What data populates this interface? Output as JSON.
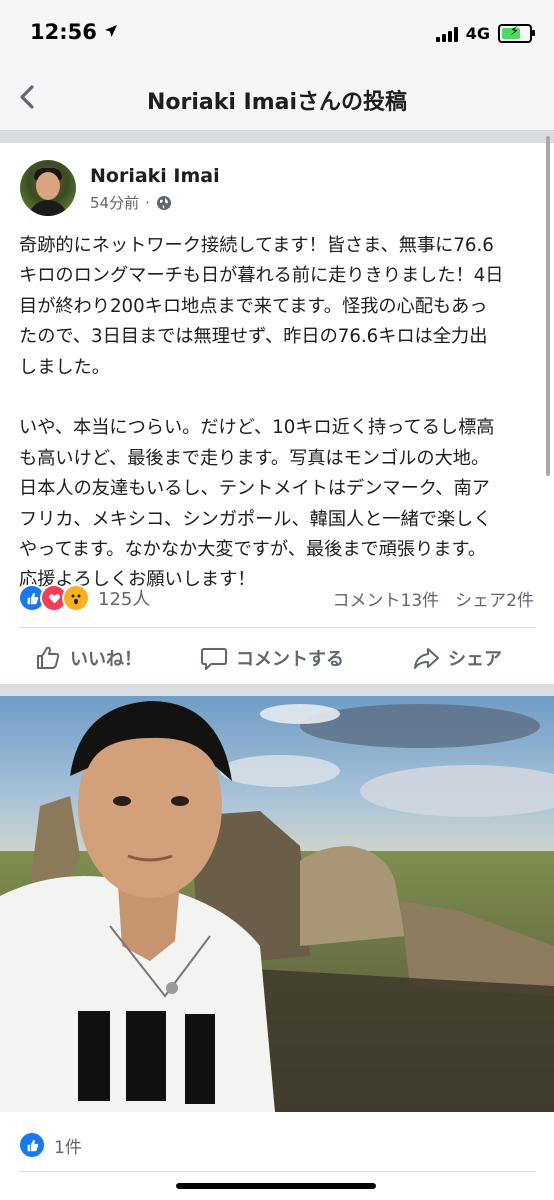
{
  "status_bar": {
    "time": "12:56",
    "network": "4G"
  },
  "nav": {
    "title": "Noriaki Imaiさんの投稿"
  },
  "post": {
    "author": "Noriaki Imai",
    "time": "54分前",
    "text": "奇跡的にネットワーク接続してます！皆さま、無事に76.6\nキロのロングマーチも日が暮れる前に走りきりました！4日\n目が終わり200キロ地点まで来てます。怪我の心配もあっ\nたので、3日目までは無理せず、昨日の76.6キロは全力出\nしました。\n\nいや、本当につらい。だけど、10キロ近く持ってるし標高\nも高いけど、最後まで走ります。写真はモンゴルの大地。\n日本人の友達もいるし、テントメイトはデンマーク、南ア\nフリカ、メキシコ、シンガポール、韓国人と一緒で楽しく\nやってます。なかなか大変ですが、最後まで頑張ります。\n応援よろしくお願いします！",
    "reaction_count": "125人",
    "comment_count": "コメント13件",
    "share_count": "シェア2件"
  },
  "actions": {
    "like": "いいね！",
    "comment": "コメントする",
    "share": "シェア"
  },
  "photo": {
    "like_count": "1件"
  },
  "colors": {
    "accent": "#1877f2",
    "love": "#f33e58",
    "wow": "#f7b125"
  }
}
